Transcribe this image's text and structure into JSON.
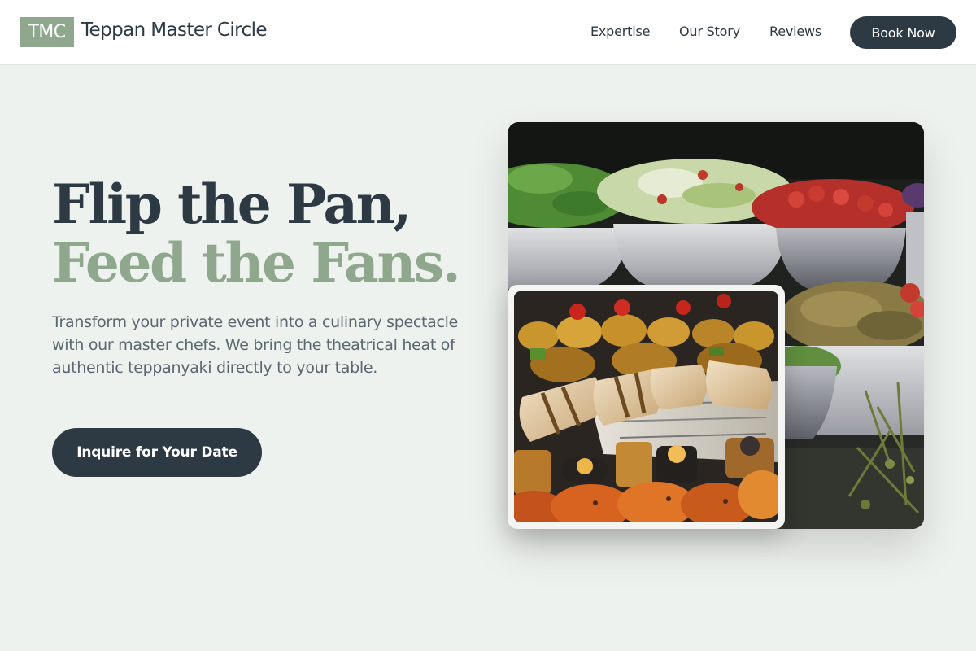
{
  "header": {
    "logo_badge": "TMC",
    "brand_name": "Teppan Master Circle",
    "nav": [
      "Expertise",
      "Our Story",
      "Reviews"
    ],
    "book_button": "Book Now"
  },
  "hero": {
    "title_line1": "Flip the Pan,",
    "title_line2": "Feed the Fans.",
    "description": "Transform your private event into a culinary spectacle with our master chefs. We bring the theatrical heat of authentic teppanyaki directly to your table.",
    "cta_button": "Inquire for Your Date"
  },
  "images": {
    "main": "salad-buffet-bowls-photo",
    "inset": "appetizer-platter-photo"
  },
  "colors": {
    "accent": "#8fa88d",
    "dark": "#2d3a44",
    "background": "#eef2ee",
    "text_muted": "#5b6770"
  }
}
